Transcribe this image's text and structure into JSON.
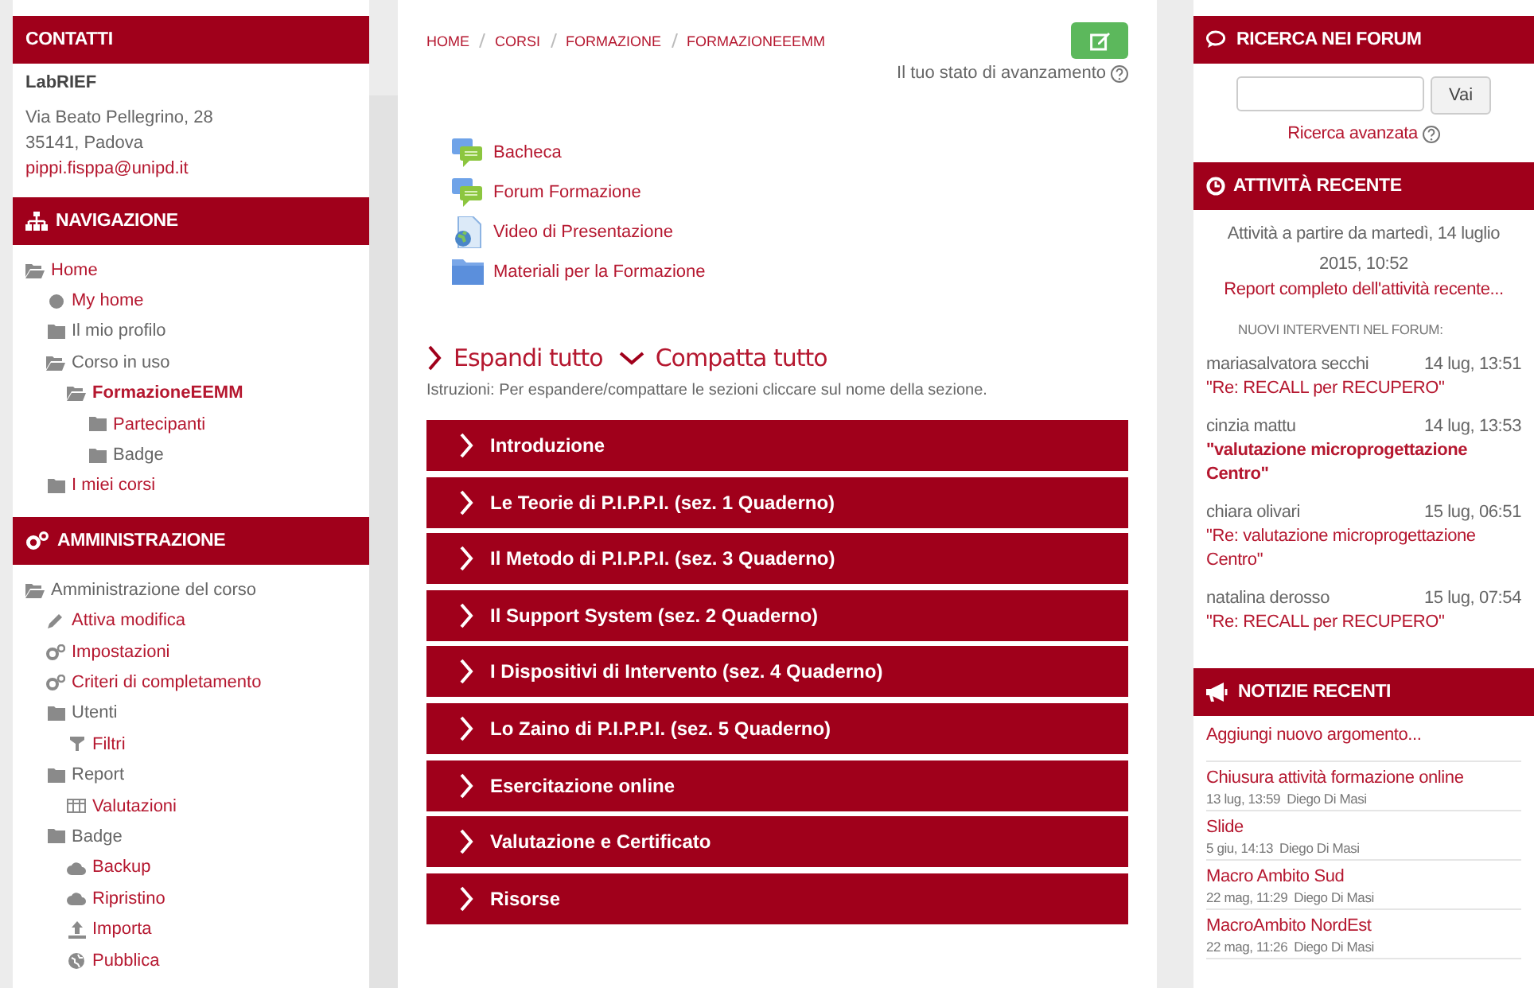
{
  "left": {
    "contacts": {
      "title": "CONTATTI",
      "name": "LabRIEF",
      "address": [
        "Via Beato Pellegrino, 28",
        "35141, Padova"
      ],
      "email": "pippi.fisppa@unipd.it"
    },
    "navigation": {
      "title": "NAVIGAZIONE",
      "items": [
        {
          "label": "Home",
          "kind": "folder-open",
          "link": true,
          "current": false,
          "children": [
            {
              "label": "My home",
              "kind": "dot",
              "link": true,
              "current": false
            },
            {
              "label": "Il mio profilo",
              "kind": "folder",
              "link": false,
              "current": false
            },
            {
              "label": "Corso in uso",
              "kind": "folder-open",
              "link": false,
              "current": false,
              "children": [
                {
                  "label": "FormazioneEEMM",
                  "kind": "folder-open",
                  "link": true,
                  "current": true,
                  "children": [
                    {
                      "label": "Partecipanti",
                      "kind": "folder",
                      "link": true,
                      "current": false
                    },
                    {
                      "label": "Badge",
                      "kind": "folder",
                      "link": false,
                      "current": false
                    }
                  ]
                }
              ]
            },
            {
              "label": "I miei corsi",
              "kind": "folder",
              "link": true,
              "current": false
            }
          ]
        }
      ]
    },
    "administration": {
      "title": "AMMINISTRAZIONE",
      "items": [
        {
          "label": "Amministrazione del corso",
          "kind": "folder-open",
          "link": false,
          "current": false,
          "children": [
            {
              "label": "Attiva modifica",
              "kind": "pencil",
              "link": true,
              "current": false
            },
            {
              "label": "Impostazioni",
              "kind": "gears",
              "link": true,
              "current": false
            },
            {
              "label": "Criteri di completamento",
              "kind": "gears",
              "link": true,
              "current": false
            },
            {
              "label": "Utenti",
              "kind": "folder",
              "link": false,
              "current": false,
              "children": [
                {
                  "label": "Filtri",
                  "kind": "filter",
                  "link": true,
                  "current": false
                }
              ]
            },
            {
              "label": "Report",
              "kind": "folder",
              "link": false,
              "current": false,
              "children": [
                {
                  "label": "Valutazioni",
                  "kind": "table",
                  "link": true,
                  "current": false
                }
              ]
            },
            {
              "label": "Badge",
              "kind": "folder",
              "link": false,
              "current": false,
              "children": [
                {
                  "label": "Backup",
                  "kind": "cloud",
                  "link": true,
                  "current": false
                },
                {
                  "label": "Ripristino",
                  "kind": "cloud",
                  "link": true,
                  "current": false
                },
                {
                  "label": "Importa",
                  "kind": "upload",
                  "link": true,
                  "current": false
                },
                {
                  "label": "Pubblica",
                  "kind": "globe",
                  "link": true,
                  "current": false
                }
              ]
            }
          ]
        }
      ]
    }
  },
  "main": {
    "breadcrumb": [
      "HOME",
      "CORSI",
      "FORMAZIONE",
      "FORMAZIONEEEMM"
    ],
    "progress_label": "Il tuo stato di avanzamento",
    "activities": [
      {
        "label": "Bacheca",
        "kind": "forum"
      },
      {
        "label": "Forum Formazione",
        "kind": "forum"
      },
      {
        "label": "Video di Presentazione",
        "kind": "url"
      },
      {
        "label": "Materiali per la Formazione",
        "kind": "folder"
      }
    ],
    "expand_all": "Espandi tutto",
    "collapse_all": "Compatta tutto",
    "instructions": "Istruzioni: Per espandere/compattare le sezioni cliccare sul nome della sezione.",
    "sections": [
      {
        "title": "Introduzione",
        "expanded": false
      },
      {
        "title": "Le Teorie di P.I.P.P.I. (sez. 1 Quaderno)",
        "expanded": false
      },
      {
        "title": "Il Metodo di P.I.P.P.I. (sez. 3 Quaderno)",
        "expanded": false
      },
      {
        "title": "Il Support System (sez. 2 Quaderno)",
        "expanded": false
      },
      {
        "title": "I Dispositivi di Intervento (sez. 4 Quaderno)",
        "expanded": false
      },
      {
        "title": "Lo Zaino di P.I.P.P.I. (sez. 5 Quaderno)",
        "expanded": false
      },
      {
        "title": "Esercitazione online",
        "expanded": false
      },
      {
        "title": "Valutazione e Certificato",
        "expanded": false
      },
      {
        "title": "Risorse",
        "expanded": false
      }
    ]
  },
  "right": {
    "forum_search": {
      "title": "RICERCA NEI FORUM",
      "button": "Vai",
      "advanced": "Ricerca avanzata"
    },
    "recent_activity": {
      "title": "ATTIVITÀ RECENTE",
      "since": "Attività a partire da martedì, 14 luglio 2015, 10:52",
      "report_link": "Report completo dell'attività recente...",
      "posts_heading": "NUOVI INTERVENTI NEL FORUM:",
      "posts": [
        {
          "author": "mariasalvatora secchi",
          "time": "14 lug, 13:51",
          "subject": "\"Re: RECALL per RECUPERO\"",
          "unread": false
        },
        {
          "author": "cinzia mattu",
          "time": "14 lug, 13:53",
          "subject": "\"valutazione microprogettazione Centro\"",
          "unread": true
        },
        {
          "author": "chiara olivari",
          "time": "15 lug, 06:51",
          "subject": "\"Re: valutazione microprogettazione Centro\"",
          "unread": false
        },
        {
          "author": "natalina derosso",
          "time": "15 lug, 07:54",
          "subject": "\"Re: RECALL per RECUPERO\"",
          "unread": false
        }
      ]
    },
    "news": {
      "title": "NOTIZIE RECENTI",
      "add_link": "Aggiungi nuovo argomento...",
      "items": [
        {
          "title": "Chiusura attività formazione online",
          "date": "13 lug, 13:59",
          "author": "Diego Di Masi"
        },
        {
          "title": "Slide",
          "date": "5 giu, 14:13",
          "author": "Diego Di Masi"
        },
        {
          "title": "Macro Ambito Sud",
          "date": "22 mag, 11:29",
          "author": "Diego Di Masi"
        },
        {
          "title": "MacroAmbito NordEst",
          "date": "22 mag, 11:26",
          "author": "Diego Di Masi"
        }
      ]
    }
  }
}
